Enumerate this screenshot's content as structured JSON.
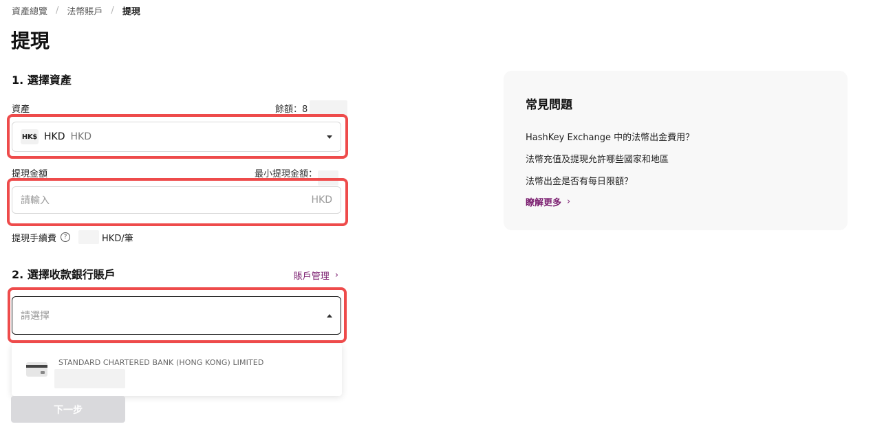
{
  "breadcrumb": {
    "items": [
      "資產總覽",
      "法幣賬戶",
      "提現"
    ],
    "separator": "/"
  },
  "page": {
    "title": "提現"
  },
  "step1": {
    "title": "1. 選擇資產",
    "asset_label": "資產",
    "balance_label": "餘額：8",
    "asset_icon_text": "HK$",
    "asset_symbol": "HKD",
    "asset_name": "HKD",
    "amount_label": "提現金額",
    "min_amount_label": "最小提現金額：",
    "amount_placeholder": "請輸入",
    "amount_unit": "HKD",
    "fee_label": "提現手續費",
    "fee_help_icon": "?",
    "fee_value": "HKD/筆"
  },
  "step2": {
    "title": "2. 選擇收款銀行賬戶",
    "manage_link": "賬戶管理",
    "manage_chevron": "›",
    "bank_placeholder": "請選擇",
    "bank_options": [
      {
        "name": "STANDARD CHARTERED BANK (HONG KONG) LIMITED"
      }
    ]
  },
  "actions": {
    "next_label": "下一步"
  },
  "faq": {
    "title": "常見問題",
    "items": [
      "HashKey Exchange 中的法幣出金費用？",
      "法幣充值及提現允許哪些國家和地區",
      "法幣出金是否有每日限額？"
    ],
    "more_label": "瞭解更多",
    "more_chevron": "›"
  },
  "colors": {
    "accent": "#7a1d6f",
    "annotation": "#ee4b4b",
    "button_disabled": "#d9d9dc"
  }
}
